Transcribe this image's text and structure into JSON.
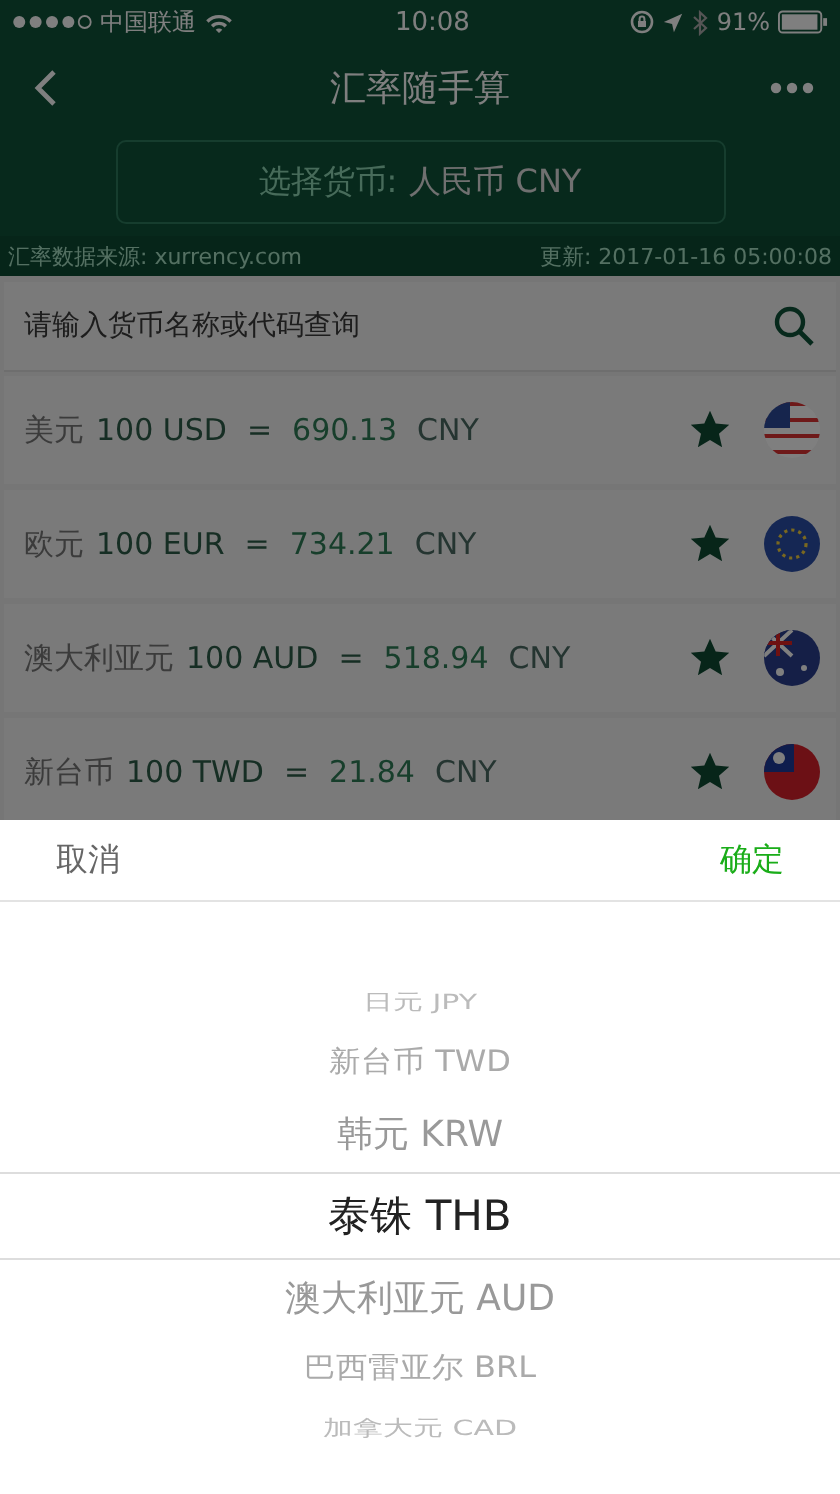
{
  "status_bar": {
    "carrier": "中国联通",
    "time": "10:08",
    "battery": "91%"
  },
  "nav": {
    "title": "汇率随手算"
  },
  "selector": {
    "label": "选择货币:",
    "value": "人民币 CNY"
  },
  "source_bar": {
    "source": "汇率数据来源: xurrency.com",
    "updated": "更新: 2017-01-16 05:00:08"
  },
  "search": {
    "placeholder": "请输入货币名称或代码查询"
  },
  "rates": [
    {
      "name": "美元",
      "amount": "100 USD",
      "equals": "=",
      "value": "690.13",
      "base": "CNY",
      "starred": true
    },
    {
      "name": "欧元",
      "amount": "100 EUR",
      "equals": "=",
      "value": "734.21",
      "base": "CNY",
      "starred": true
    },
    {
      "name": "澳大利亚元",
      "amount": "100 AUD",
      "equals": "=",
      "value": "518.94",
      "base": "CNY",
      "starred": true
    },
    {
      "name": "新台币",
      "amount": "100 TWD",
      "equals": "=",
      "value": "21.84",
      "base": "CNY",
      "starred": true
    }
  ],
  "picker": {
    "cancel": "取消",
    "confirm": "确定",
    "options": [
      {
        "label": "日元 JPY",
        "selected": false
      },
      {
        "label": "新台币 TWD",
        "selected": false
      },
      {
        "label": "韩元 KRW",
        "selected": false
      },
      {
        "label": "泰铢 THB",
        "selected": true
      },
      {
        "label": "澳大利亚元 AUD",
        "selected": false
      },
      {
        "label": "巴西雷亚尔 BRL",
        "selected": false
      },
      {
        "label": "加拿大元 CAD",
        "selected": false
      }
    ]
  }
}
